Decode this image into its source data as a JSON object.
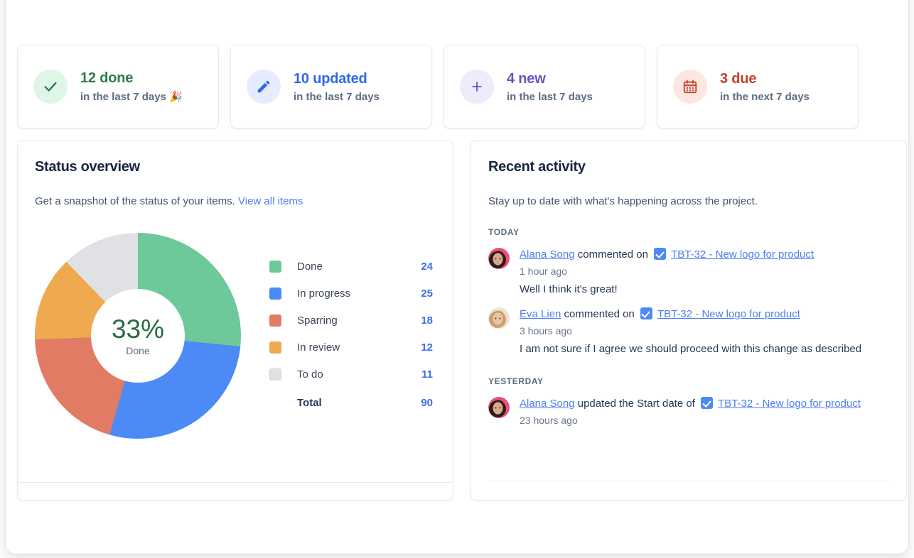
{
  "stats": [
    {
      "id": "done",
      "icon": "check-icon",
      "count": "12 done",
      "sub": "in the last 7 days 🎉",
      "color": "#2f7a4d",
      "bg": "#dff5e7"
    },
    {
      "id": "updated",
      "icon": "pencil-icon",
      "count": "10 updated",
      "sub": "in the last 7 days",
      "color": "#2f68e8",
      "bg": "#e6ecfd"
    },
    {
      "id": "new",
      "icon": "plus-icon",
      "count": "4 new",
      "sub": "in the last 7 days",
      "color": "#6554c0",
      "bg": "#eeebfb"
    },
    {
      "id": "due",
      "icon": "calendar-icon",
      "count": "3 due",
      "sub": "in the next 7 days",
      "color": "#c4402c",
      "bg": "#fbe6e2"
    }
  ],
  "status_overview": {
    "title": "Status overview",
    "description": "Get a snapshot of the status of your items.",
    "link_label": "View all items",
    "center_percent": "33%",
    "center_label": "Done",
    "total_label": "Total",
    "total_value": "90"
  },
  "chart_data": {
    "type": "pie",
    "title": "Status overview",
    "categories": [
      "Done",
      "In progress",
      "Sparring",
      "In review",
      "To do"
    ],
    "values": [
      24,
      25,
      18,
      12,
      11
    ],
    "colors": [
      "#6dc999",
      "#4c8bf5",
      "#e27b63",
      "#efa94e",
      "#dfe1e5"
    ],
    "total": 90,
    "center_percent": 33,
    "center_label": "Done",
    "legend": "right",
    "donut": true,
    "hole_ratio": 0.455,
    "start_angle_deg": 0,
    "direction": "clockwise"
  },
  "recent_activity": {
    "title": "Recent activity",
    "description": "Stay up to date with what's happening across the project.",
    "groups": [
      {
        "label": "TODAY",
        "items": [
          {
            "user": "Alana Song",
            "action": "commented on",
            "task_key_title": "TBT-32 - New logo for product",
            "time": "1 hour ago",
            "comment": "Well I think it's great!",
            "avatar_skin": "#d8a98e",
            "avatar_hair": "#2d1c18",
            "avatar_bg": "#ef4d7a"
          },
          {
            "user": "Eva Lien",
            "action": "commented on",
            "task_key_title": "TBT-32 - New logo for product",
            "time": "3 hours ago",
            "comment": "I am not sure if I agree we should proceed with this change as described",
            "avatar_skin": "#e8c4a6",
            "avatar_hair": "#c9a06a",
            "avatar_bg": "#efe0cf"
          }
        ]
      },
      {
        "label": "YESTERDAY",
        "items": [
          {
            "user": "Alana Song",
            "action": "updated the Start date of",
            "task_key_title": "TBT-32 - New logo for product",
            "time": "23 hours ago",
            "comment": "",
            "avatar_skin": "#d8a98e",
            "avatar_hair": "#2d1c18",
            "avatar_bg": "#ef4d7a"
          }
        ]
      }
    ]
  }
}
